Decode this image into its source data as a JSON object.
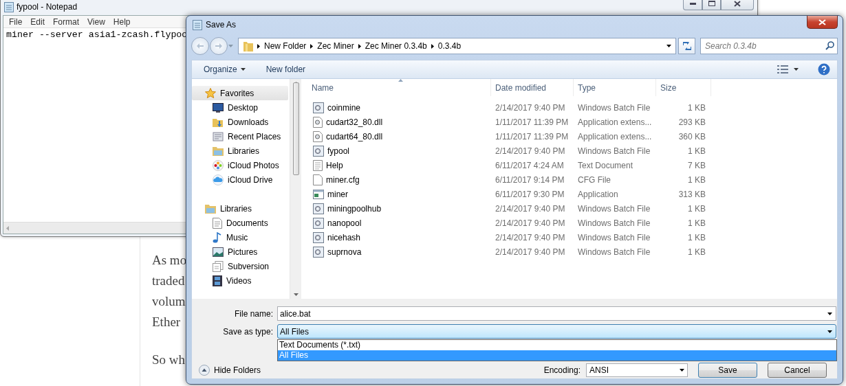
{
  "article": {
    "paragraphs": [
      [
        "As mo",
        "traded",
        "volum",
        "Ether"
      ],
      [
        "So wh"
      ]
    ]
  },
  "notepad": {
    "title": "fypool - Notepad",
    "menu": [
      "File",
      "Edit",
      "Format",
      "View",
      "Help"
    ],
    "text": "miner --server asia1-zcash.flypoo"
  },
  "dialog": {
    "title": "Save As",
    "breadcrumb": [
      "New Folder",
      "Zec Miner",
      "Zec Miner 0.3.4b",
      "0.3.4b"
    ],
    "search": {
      "placeholder": "Search 0.3.4b"
    },
    "toolbar": {
      "organize": "Organize",
      "new_folder": "New folder"
    },
    "nav": [
      {
        "label": "Favorites",
        "kind": "favorites",
        "selected": true,
        "children": [
          {
            "label": "Desktop",
            "kind": "desktop",
            "selected": false
          },
          {
            "label": "Downloads",
            "kind": "downloads",
            "selected": false
          },
          {
            "label": "Recent Places",
            "kind": "recent",
            "selected": false
          },
          {
            "label": "Libraries",
            "kind": "libraries",
            "selected": false
          },
          {
            "label": "iCloud Photos",
            "kind": "photos",
            "selected": false
          },
          {
            "label": "iCloud Drive",
            "kind": "cloud",
            "selected": false
          }
        ]
      },
      {
        "label": "Libraries",
        "kind": "libraries",
        "selected": false,
        "children": [
          {
            "label": "Documents",
            "kind": "documents",
            "selected": false
          },
          {
            "label": "Music",
            "kind": "music",
            "selected": false
          },
          {
            "label": "Pictures",
            "kind": "pictures",
            "selected": false
          },
          {
            "label": "Subversion",
            "kind": "subversion",
            "selected": false
          },
          {
            "label": "Videos",
            "kind": "videos",
            "selected": false
          }
        ]
      }
    ],
    "columns": [
      {
        "label": "Name",
        "sorted": true
      },
      {
        "label": "Date modified",
        "sorted": false
      },
      {
        "label": "Type",
        "sorted": false
      },
      {
        "label": "Size",
        "sorted": false
      }
    ],
    "files": [
      {
        "name": "coinmine",
        "date": "2/14/2017 9:40 PM",
        "type": "Windows Batch File",
        "size": "1 KB",
        "kind": "batch"
      },
      {
        "name": "cudart32_80.dll",
        "date": "1/11/2017 11:39 PM",
        "type": "Application extens...",
        "size": "293 KB",
        "kind": "dll"
      },
      {
        "name": "cudart64_80.dll",
        "date": "1/11/2017 11:39 PM",
        "type": "Application extens...",
        "size": "360 KB",
        "kind": "dll"
      },
      {
        "name": "fypool",
        "date": "2/14/2017 9:40 PM",
        "type": "Windows Batch File",
        "size": "1 KB",
        "kind": "batch"
      },
      {
        "name": "Help",
        "date": "6/11/2017 4:24 AM",
        "type": "Text Document",
        "size": "7 KB",
        "kind": "text"
      },
      {
        "name": "miner.cfg",
        "date": "6/11/2017 9:14 PM",
        "type": "CFG File",
        "size": "1 KB",
        "kind": "file"
      },
      {
        "name": "miner",
        "date": "6/11/2017 9:30 PM",
        "type": "Application",
        "size": "313 KB",
        "kind": "app"
      },
      {
        "name": "miningpoolhub",
        "date": "2/14/2017 9:40 PM",
        "type": "Windows Batch File",
        "size": "1 KB",
        "kind": "batch"
      },
      {
        "name": "nanopool",
        "date": "2/14/2017 9:40 PM",
        "type": "Windows Batch File",
        "size": "1 KB",
        "kind": "batch"
      },
      {
        "name": "nicehash",
        "date": "2/14/2017 9:40 PM",
        "type": "Windows Batch File",
        "size": "1 KB",
        "kind": "batch"
      },
      {
        "name": "suprnova",
        "date": "2/14/2017 9:40 PM",
        "type": "Windows Batch File",
        "size": "1 KB",
        "kind": "batch"
      }
    ],
    "file_name": {
      "label": "File name:",
      "value": "alice.bat"
    },
    "save_as_type": {
      "label": "Save as type:",
      "value": "All Files",
      "expanded": true,
      "options": [
        {
          "label": "Text Documents (*.txt)",
          "selected": false
        },
        {
          "label": "All Files",
          "selected": true
        }
      ]
    },
    "hide_folders": "Hide Folders",
    "encoding": {
      "label": "Encoding:",
      "value": "ANSI"
    },
    "buttons": [
      "Save",
      "Cancel"
    ]
  }
}
